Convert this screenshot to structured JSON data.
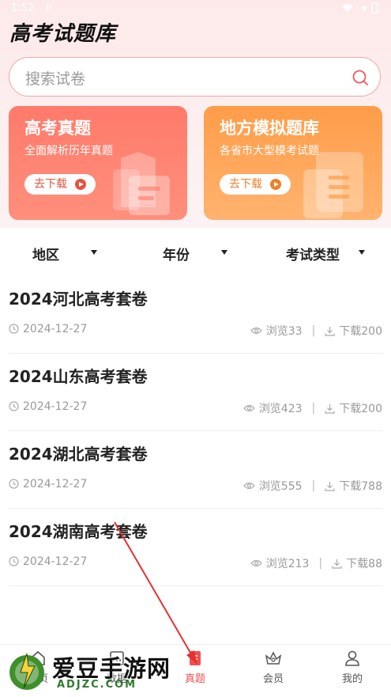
{
  "status": {
    "time": "1:52",
    "icon_label": "P"
  },
  "header": {
    "title": "高考试题库"
  },
  "search": {
    "placeholder": "搜索试卷"
  },
  "banners": [
    {
      "title": "高考真题",
      "subtitle": "全面解析历年真题",
      "button": "去下载",
      "color": "#ff7a6a"
    },
    {
      "title": "地方模拟题库",
      "subtitle": "各省市大型模考试题",
      "button": "去下载",
      "color": "#ff9c48"
    }
  ],
  "filters": [
    {
      "label": "地区"
    },
    {
      "label": "年份"
    },
    {
      "label": "考试类型"
    }
  ],
  "papers": [
    {
      "title": "2024河北高考套卷",
      "date": "2024-12-27",
      "views": "浏览33",
      "downloads": "下载200"
    },
    {
      "title": "2024山东高考套卷",
      "date": "2024-12-27",
      "views": "浏览423",
      "downloads": "下载200"
    },
    {
      "title": "2024湖北高考套卷",
      "date": "2024-12-27",
      "views": "浏览555",
      "downloads": "下载788"
    },
    {
      "title": "2024湖南高考套卷",
      "date": "2024-12-27",
      "views": "浏览213",
      "downloads": "下载88"
    }
  ],
  "tabs": [
    {
      "label": "首页",
      "icon": "home-icon"
    },
    {
      "label": "数据",
      "icon": "data-icon"
    },
    {
      "label": "真题",
      "icon": "exam-icon",
      "active": true
    },
    {
      "label": "会员",
      "icon": "crown-icon"
    },
    {
      "label": "我的",
      "icon": "user-icon"
    }
  ],
  "watermark": {
    "text": "爱豆手游网",
    "url": "ADJZC.COM"
  },
  "colors": {
    "accent": "#f25050",
    "search_border": "#f3a6a6"
  }
}
